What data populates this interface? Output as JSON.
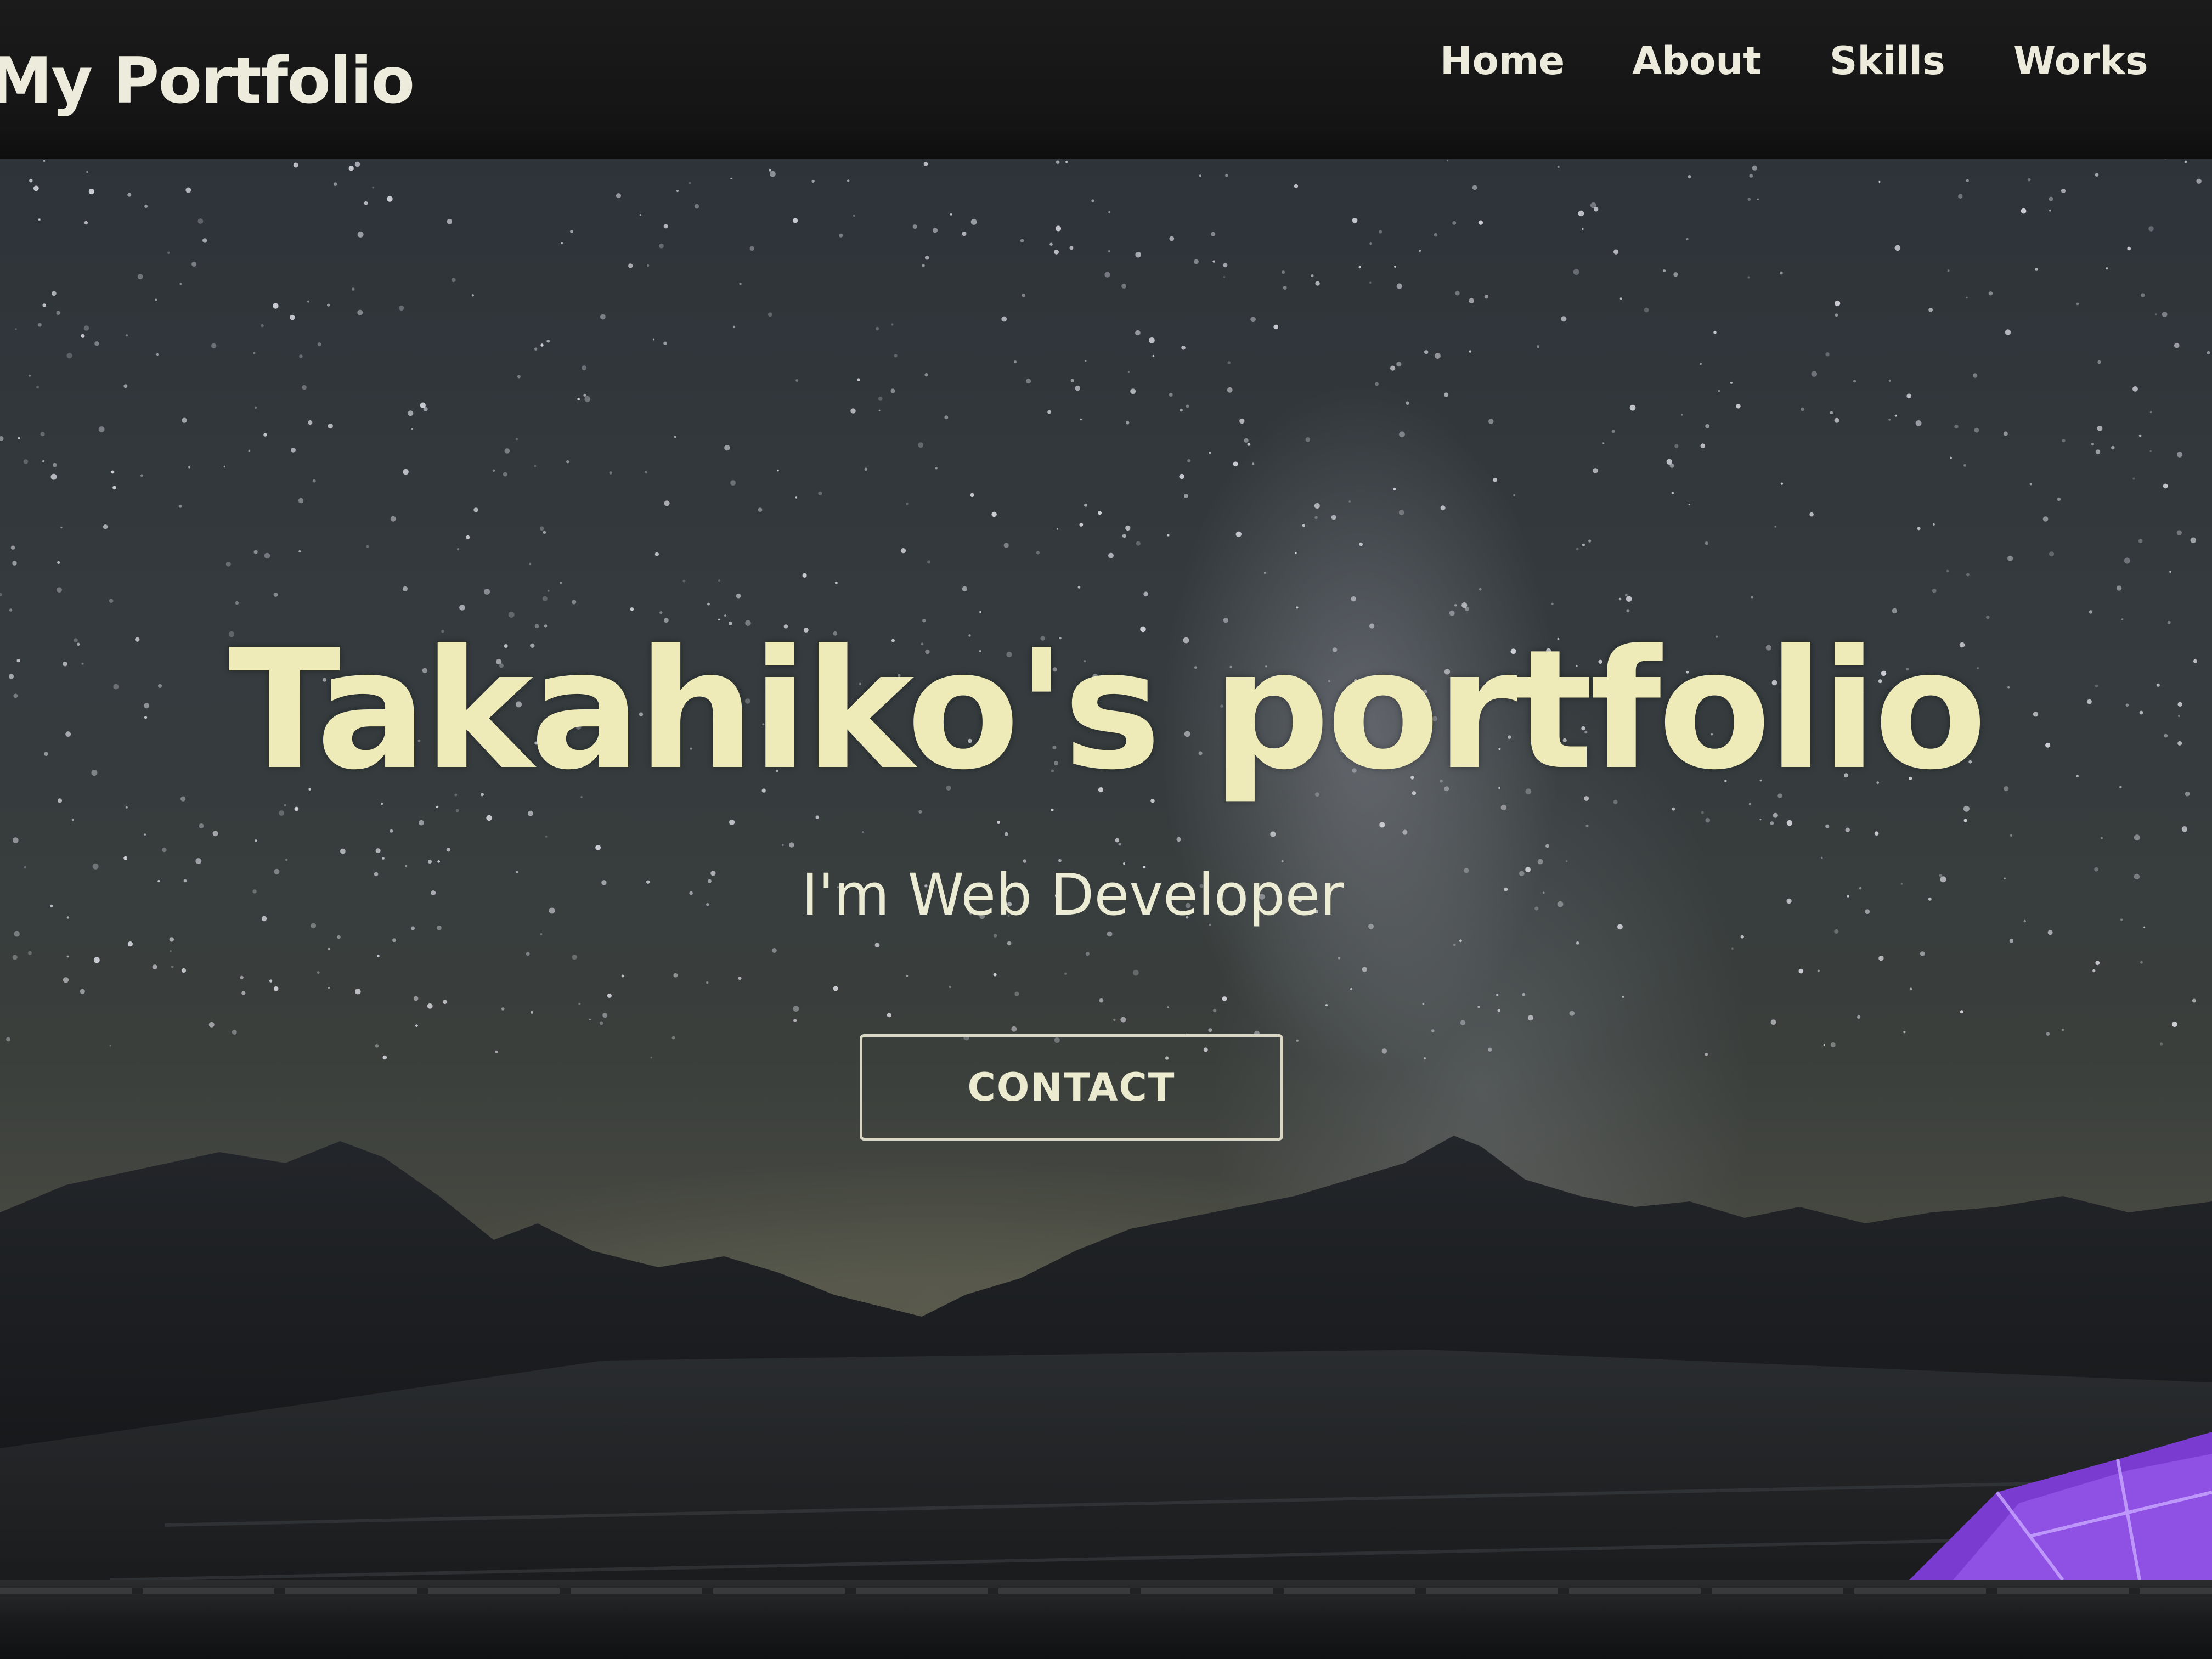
{
  "navbar": {
    "brand": "My Portfolio",
    "items": [
      {
        "label": "Home"
      },
      {
        "label": "About"
      },
      {
        "label": "Skills"
      },
      {
        "label": "Works"
      }
    ]
  },
  "hero": {
    "title": "Takahiko's portfolio",
    "subtitle": "I'm Web Developer",
    "button_label": "CONTACT"
  },
  "colors": {
    "navbar_bg": "#161616",
    "nav_text": "#ecebdc",
    "hero_title": "#eeebb8",
    "button_border": "#d9d6c4",
    "tent_accent": "#8b45e0"
  }
}
